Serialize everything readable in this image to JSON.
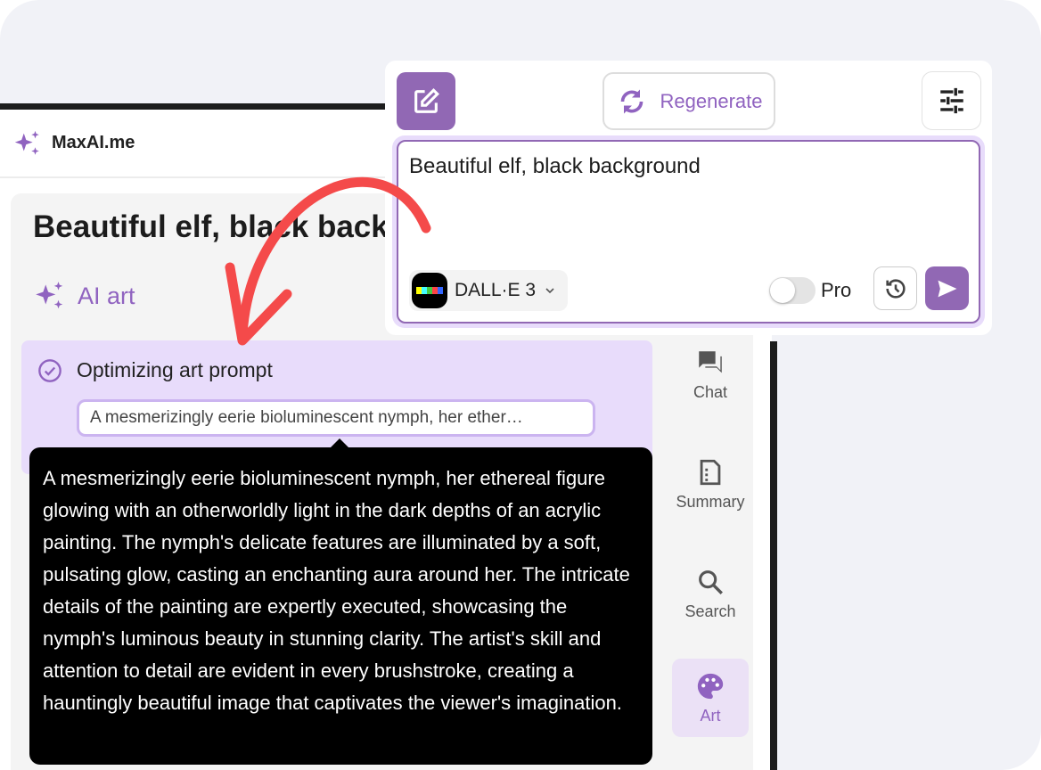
{
  "app": {
    "brand": "MaxAI.me",
    "title": "Beautiful elf, black background",
    "mode_label": "AI art"
  },
  "step": {
    "label": "Optimizing art prompt",
    "prompt_preview": "A mesmerizingly eerie bioluminescent nymph, her ether…",
    "full_prompt": "A mesmerizingly eerie bioluminescent nymph, her ethereal figure glowing with an otherworldly light in the dark depths of an acrylic painting. The nymph's delicate features are illuminated by a soft, pulsating glow, casting an enchanting aura around her. The intricate details of the painting are expertly executed, showcasing the nymph's luminous beauty in stunning clarity. The artist's skill and attention to detail are evident in every brushstroke, creating a hauntingly beautiful image that captivates the viewer's imagination."
  },
  "sidebar": {
    "items": [
      {
        "label": "Chat",
        "icon": "chat-icon"
      },
      {
        "label": "Summary",
        "icon": "summary-icon"
      },
      {
        "label": "Search",
        "icon": "search-icon"
      },
      {
        "label": "Art",
        "icon": "palette-icon",
        "active": true
      }
    ]
  },
  "panel": {
    "regenerate_label": "Regenerate",
    "input_value": "Beautiful elf, black background",
    "model": "DALL·E 3",
    "pro_label": "Pro",
    "pro_enabled": false
  },
  "colors": {
    "accent": "#9168b4",
    "step_bg": "#e8dcfb",
    "annotation_arrow": "#f44a4a"
  }
}
